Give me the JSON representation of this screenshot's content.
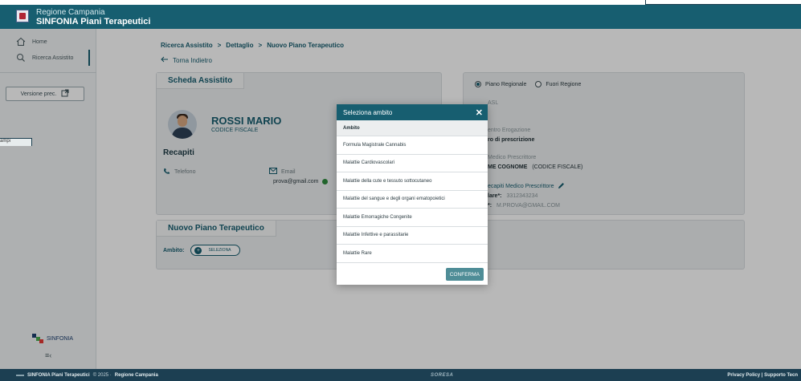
{
  "header": {
    "org": "Regione Campania",
    "app": "SINFONIA Piani Terapeutici"
  },
  "sidebar": {
    "items": [
      {
        "label": "Home",
        "icon": "home-icon"
      },
      {
        "label": "Ricerca Assistito",
        "icon": "search-icon"
      }
    ],
    "version_label": "Versione prec.",
    "logo_text": "SINFONIA",
    "toggle_glyph": "≡‹",
    "clipped_tag": "ampi"
  },
  "breadcrumb": {
    "items": [
      "Ricerca Assistito",
      "Dettaglio",
      "Nuovo Piano Terapeutico"
    ],
    "separator": ">"
  },
  "back_label": "Torna Indietro",
  "scheda": {
    "title": "Scheda Assistito",
    "name": "ROSSI MARIO",
    "code": "CODICE FISCALE",
    "recapiti_title": "Recapiti",
    "phone_label": "Telefono",
    "email_label": "Email",
    "email_value": "prova@gmail.com"
  },
  "nuovo_piano": {
    "title": "Nuovo Piano Terapeutico",
    "ambito_label": "Ambito:",
    "select_label": "SELEZIONA"
  },
  "right_panel": {
    "radio_regionale": "Piano Regionale",
    "radio_fuori": "Fuori Regione",
    "asl": "ASL",
    "centro_label": "entro Erogazione",
    "centro_value": "ro di prescrizione",
    "medico_label": "Medico Prescrittore",
    "medico_value": "ME COGNOME",
    "medico_code": "(CODICE FISCALE)",
    "recapiti_label": "ecapiti Medico Prescrittore",
    "cell_label": "lare*:",
    "cell_value": "3312343234",
    "mail_label": "*:",
    "mail_value": "M.PROVA@GMAIL.COM"
  },
  "modal": {
    "title": "Seleziona ambito",
    "close_glyph": "✕",
    "header_row": "Ambito",
    "options": [
      "Formula Magistrale Cannabis",
      "Malattie Cardiovascolari",
      "Malattie della cute e tessuto sottocutaneo",
      "Malattie del sangue e degli organi ematopoietici",
      "Malattie Emorragiche Congenite",
      "Malattie Infettive e parassitarie",
      "Malattie Rare"
    ],
    "confirm_label": "CONFERMA"
  },
  "footer": {
    "left_app": "SINFONIA Piani Terapeutici",
    "left_copy": "© 2025 ·",
    "left_region": "Regione Campania",
    "mid_brand": "SORESA",
    "right_links": "Privacy Policy | Supporto Tecn"
  },
  "colors": {
    "primary": "#175e70",
    "footer": "#1c3f52",
    "confirm": "#4f8d97",
    "success": "#2e8b3e"
  }
}
